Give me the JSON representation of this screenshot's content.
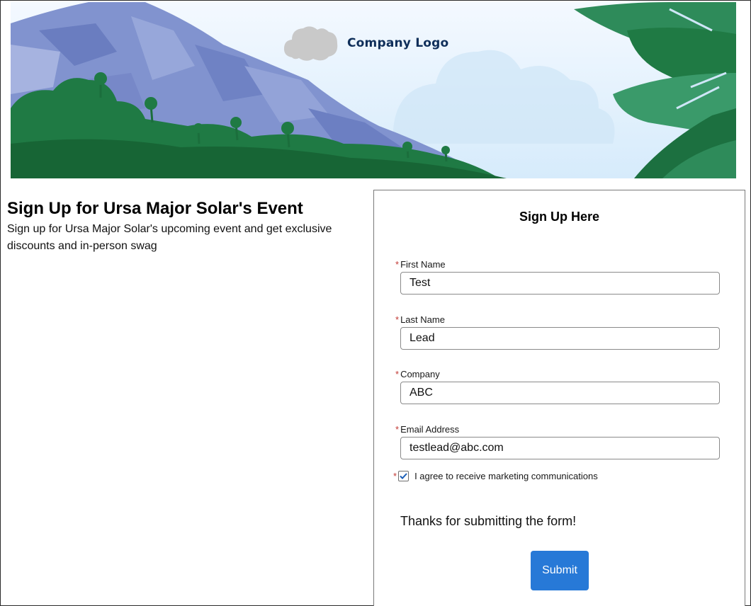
{
  "banner": {
    "logo_text": "Company Logo",
    "logo_icon": "cloud-icon",
    "colors": {
      "sky": "#dcefff",
      "mountain": "#7f92cc",
      "foliage": "#1f7a44",
      "leaves": "#2e8b5a"
    }
  },
  "intro": {
    "title": "Sign Up for Ursa Major Solar's Event",
    "description": "Sign up for Ursa Major Solar's upcoming event and get exclusive discounts and in-person swag"
  },
  "form": {
    "title": "Sign Up Here",
    "required_marker": "*",
    "fields": [
      {
        "label": "First Name",
        "value": "Test"
      },
      {
        "label": "Last Name",
        "value": "Lead"
      },
      {
        "label": "Company",
        "value": "ABC"
      },
      {
        "label": "Email Address",
        "value": "testlead@abc.com"
      }
    ],
    "consent": {
      "label": "I agree to receive marketing communications",
      "checked": true
    },
    "confirmation": "Thanks for submitting the form!",
    "submit_label": "Submit",
    "accent": "#2779d7"
  }
}
